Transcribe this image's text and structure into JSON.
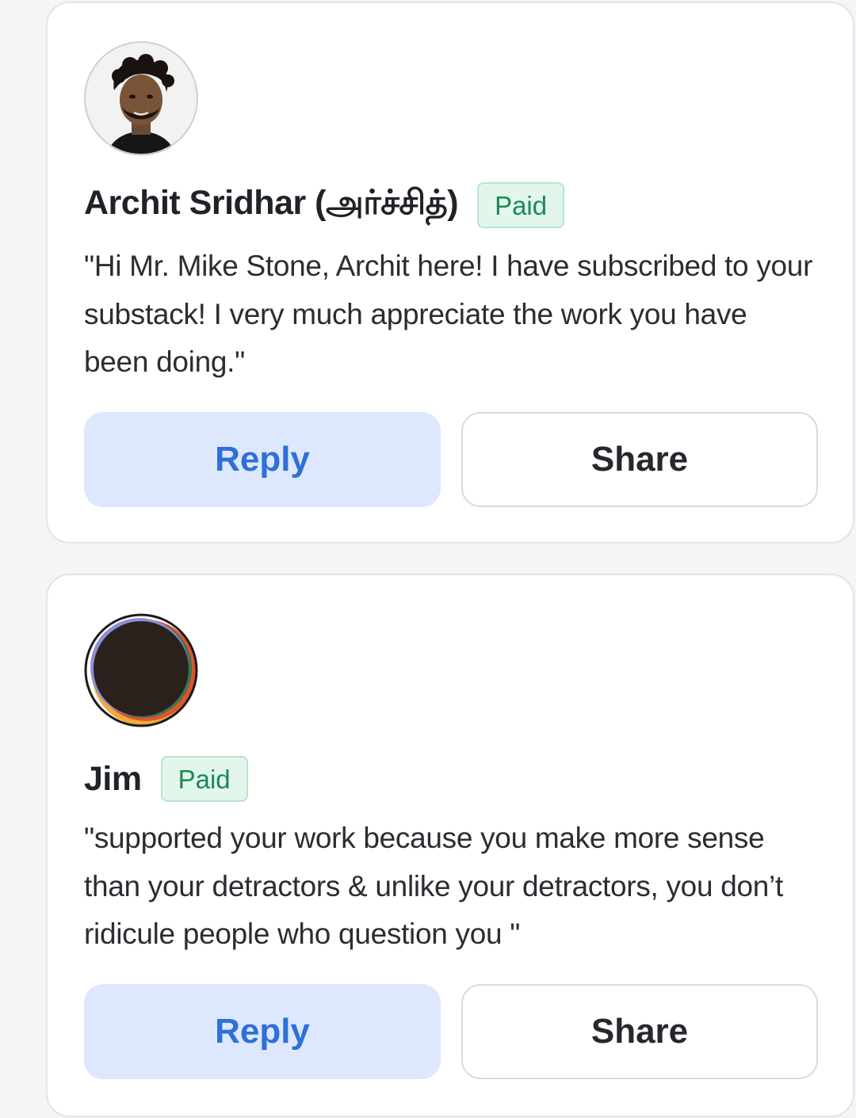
{
  "comments": [
    {
      "author": "Archit Sridhar (அர்ச்சித்)",
      "badge": "Paid",
      "message": "\"Hi Mr. Mike Stone, Archit here! I have subscribed to your substack! I very much appreciate the work you have been doing.\"",
      "reply_label": "Reply",
      "share_label": "Share"
    },
    {
      "author": "Jim",
      "badge": "Paid",
      "message": "\"supported your work because you make more sense than your detractors & unlike your detractors, you don’t ridicule people who question you \"",
      "reply_label": "Reply",
      "share_label": "Share"
    }
  ],
  "colors": {
    "reply_bg": "#dde7fd",
    "reply_text": "#2f6fd8",
    "badge_bg": "#e3f6ec",
    "badge_text": "#1a8a55"
  }
}
